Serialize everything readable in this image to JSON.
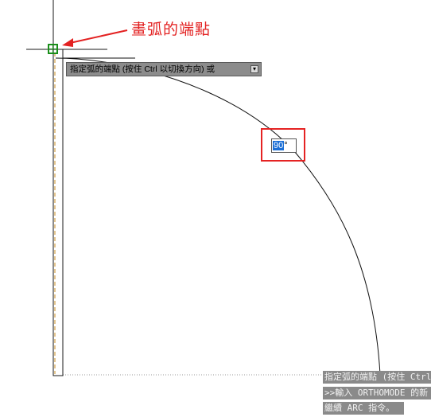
{
  "annotation": {
    "text": "畫弧的端點",
    "color": "#e32121"
  },
  "tooltip": {
    "text": "指定弧的端點 (按住 Ctrl 以切換方向) 或",
    "arrow_icon": "down-arrow-icon"
  },
  "angle_input": {
    "value": "90",
    "unit": "°"
  },
  "command_history": [
    "指定弧的端點 (按住 Ctrl",
    ">>輸入 ORTHOMODE 的新",
    "繼續 ARC 指令。"
  ],
  "colors": {
    "annotation_red": "#e32121",
    "highlight_red": "#e52323",
    "snap_marker_green": "#1a8f1a",
    "selection_blue": "#1c6fd6",
    "tooltip_gray": "#8c8c8c"
  }
}
